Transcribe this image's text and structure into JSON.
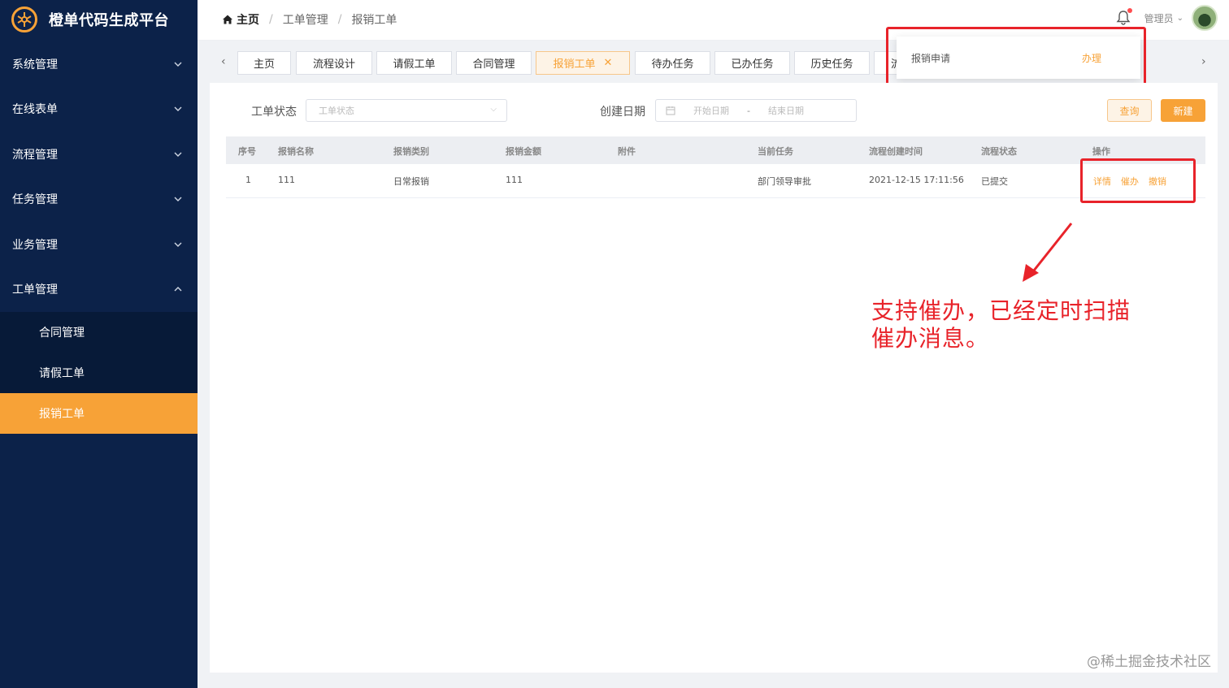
{
  "app": {
    "title": "橙单代码生成平台"
  },
  "sidebar": {
    "items": [
      {
        "label": "系统管理",
        "expanded": false
      },
      {
        "label": "在线表单",
        "expanded": false
      },
      {
        "label": "流程管理",
        "expanded": false
      },
      {
        "label": "任务管理",
        "expanded": false
      },
      {
        "label": "业务管理",
        "expanded": false
      },
      {
        "label": "工单管理",
        "expanded": true
      }
    ],
    "subitems": [
      {
        "label": "合同管理",
        "active": false
      },
      {
        "label": "请假工单",
        "active": false
      },
      {
        "label": "报销工单",
        "active": true
      }
    ]
  },
  "header": {
    "breadcrumb": [
      "主页",
      "工单管理",
      "报销工单"
    ],
    "user": "管理员"
  },
  "tabs": [
    {
      "label": "主页"
    },
    {
      "label": "流程设计"
    },
    {
      "label": "请假工单"
    },
    {
      "label": "合同管理"
    },
    {
      "label": "报销工单",
      "active": true
    },
    {
      "label": "待办任务"
    },
    {
      "label": "已办任务"
    },
    {
      "label": "历史任务"
    },
    {
      "label": "流"
    }
  ],
  "notification": {
    "title": "报销申请",
    "action": "办理"
  },
  "filters": {
    "status_label": "工单状态",
    "status_placeholder": "工单状态",
    "date_label": "创建日期",
    "date_start_placeholder": "开始日期",
    "date_separator": "-",
    "date_end_placeholder": "结束日期",
    "query_button": "查询",
    "new_button": "新建"
  },
  "table": {
    "columns": [
      "序号",
      "报销名称",
      "报销类别",
      "报销金额",
      "附件",
      "当前任务",
      "流程创建时间",
      "流程状态",
      "操作"
    ],
    "rows": [
      {
        "index": "1",
        "name": "111",
        "category": "日常报销",
        "amount": "111",
        "attachment": "",
        "current_task": "部门领导审批",
        "created": "2021-12-15 17:11:56",
        "status": "已提交",
        "actions": [
          "详情",
          "催办",
          "撤销"
        ]
      }
    ]
  },
  "annotation": {
    "line1": "支持催办，已经定时扫描",
    "line2": "催办消息。"
  },
  "watermark": "@稀土掘金技术社区",
  "colors": {
    "sidebar_bg": "#0c2249",
    "accent": "#f7a237",
    "annotation_red": "#e8232a"
  }
}
